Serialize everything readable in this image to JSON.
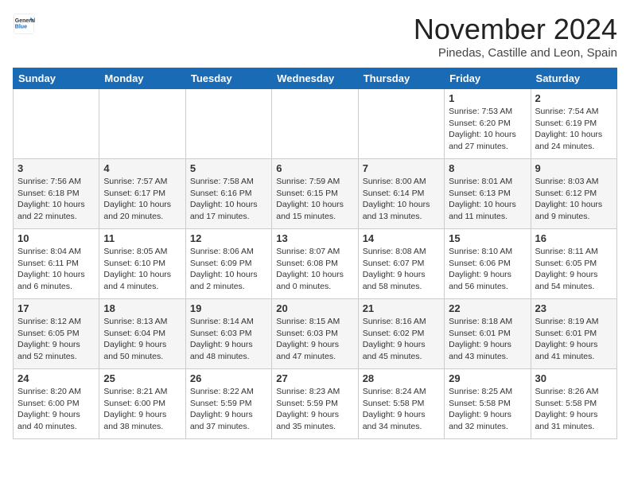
{
  "header": {
    "logo_general": "General",
    "logo_blue": "Blue",
    "month_title": "November 2024",
    "location": "Pinedas, Castille and Leon, Spain"
  },
  "weekdays": [
    "Sunday",
    "Monday",
    "Tuesday",
    "Wednesday",
    "Thursday",
    "Friday",
    "Saturday"
  ],
  "weeks": [
    [
      {
        "day": "",
        "content": ""
      },
      {
        "day": "",
        "content": ""
      },
      {
        "day": "",
        "content": ""
      },
      {
        "day": "",
        "content": ""
      },
      {
        "day": "",
        "content": ""
      },
      {
        "day": "1",
        "content": "Sunrise: 7:53 AM\nSunset: 6:20 PM\nDaylight: 10 hours and 27 minutes."
      },
      {
        "day": "2",
        "content": "Sunrise: 7:54 AM\nSunset: 6:19 PM\nDaylight: 10 hours and 24 minutes."
      }
    ],
    [
      {
        "day": "3",
        "content": "Sunrise: 7:56 AM\nSunset: 6:18 PM\nDaylight: 10 hours and 22 minutes."
      },
      {
        "day": "4",
        "content": "Sunrise: 7:57 AM\nSunset: 6:17 PM\nDaylight: 10 hours and 20 minutes."
      },
      {
        "day": "5",
        "content": "Sunrise: 7:58 AM\nSunset: 6:16 PM\nDaylight: 10 hours and 17 minutes."
      },
      {
        "day": "6",
        "content": "Sunrise: 7:59 AM\nSunset: 6:15 PM\nDaylight: 10 hours and 15 minutes."
      },
      {
        "day": "7",
        "content": "Sunrise: 8:00 AM\nSunset: 6:14 PM\nDaylight: 10 hours and 13 minutes."
      },
      {
        "day": "8",
        "content": "Sunrise: 8:01 AM\nSunset: 6:13 PM\nDaylight: 10 hours and 11 minutes."
      },
      {
        "day": "9",
        "content": "Sunrise: 8:03 AM\nSunset: 6:12 PM\nDaylight: 10 hours and 9 minutes."
      }
    ],
    [
      {
        "day": "10",
        "content": "Sunrise: 8:04 AM\nSunset: 6:11 PM\nDaylight: 10 hours and 6 minutes."
      },
      {
        "day": "11",
        "content": "Sunrise: 8:05 AM\nSunset: 6:10 PM\nDaylight: 10 hours and 4 minutes."
      },
      {
        "day": "12",
        "content": "Sunrise: 8:06 AM\nSunset: 6:09 PM\nDaylight: 10 hours and 2 minutes."
      },
      {
        "day": "13",
        "content": "Sunrise: 8:07 AM\nSunset: 6:08 PM\nDaylight: 10 hours and 0 minutes."
      },
      {
        "day": "14",
        "content": "Sunrise: 8:08 AM\nSunset: 6:07 PM\nDaylight: 9 hours and 58 minutes."
      },
      {
        "day": "15",
        "content": "Sunrise: 8:10 AM\nSunset: 6:06 PM\nDaylight: 9 hours and 56 minutes."
      },
      {
        "day": "16",
        "content": "Sunrise: 8:11 AM\nSunset: 6:05 PM\nDaylight: 9 hours and 54 minutes."
      }
    ],
    [
      {
        "day": "17",
        "content": "Sunrise: 8:12 AM\nSunset: 6:05 PM\nDaylight: 9 hours and 52 minutes."
      },
      {
        "day": "18",
        "content": "Sunrise: 8:13 AM\nSunset: 6:04 PM\nDaylight: 9 hours and 50 minutes."
      },
      {
        "day": "19",
        "content": "Sunrise: 8:14 AM\nSunset: 6:03 PM\nDaylight: 9 hours and 48 minutes."
      },
      {
        "day": "20",
        "content": "Sunrise: 8:15 AM\nSunset: 6:03 PM\nDaylight: 9 hours and 47 minutes."
      },
      {
        "day": "21",
        "content": "Sunrise: 8:16 AM\nSunset: 6:02 PM\nDaylight: 9 hours and 45 minutes."
      },
      {
        "day": "22",
        "content": "Sunrise: 8:18 AM\nSunset: 6:01 PM\nDaylight: 9 hours and 43 minutes."
      },
      {
        "day": "23",
        "content": "Sunrise: 8:19 AM\nSunset: 6:01 PM\nDaylight: 9 hours and 41 minutes."
      }
    ],
    [
      {
        "day": "24",
        "content": "Sunrise: 8:20 AM\nSunset: 6:00 PM\nDaylight: 9 hours and 40 minutes."
      },
      {
        "day": "25",
        "content": "Sunrise: 8:21 AM\nSunset: 6:00 PM\nDaylight: 9 hours and 38 minutes."
      },
      {
        "day": "26",
        "content": "Sunrise: 8:22 AM\nSunset: 5:59 PM\nDaylight: 9 hours and 37 minutes."
      },
      {
        "day": "27",
        "content": "Sunrise: 8:23 AM\nSunset: 5:59 PM\nDaylight: 9 hours and 35 minutes."
      },
      {
        "day": "28",
        "content": "Sunrise: 8:24 AM\nSunset: 5:58 PM\nDaylight: 9 hours and 34 minutes."
      },
      {
        "day": "29",
        "content": "Sunrise: 8:25 AM\nSunset: 5:58 PM\nDaylight: 9 hours and 32 minutes."
      },
      {
        "day": "30",
        "content": "Sunrise: 8:26 AM\nSunset: 5:58 PM\nDaylight: 9 hours and 31 minutes."
      }
    ]
  ]
}
